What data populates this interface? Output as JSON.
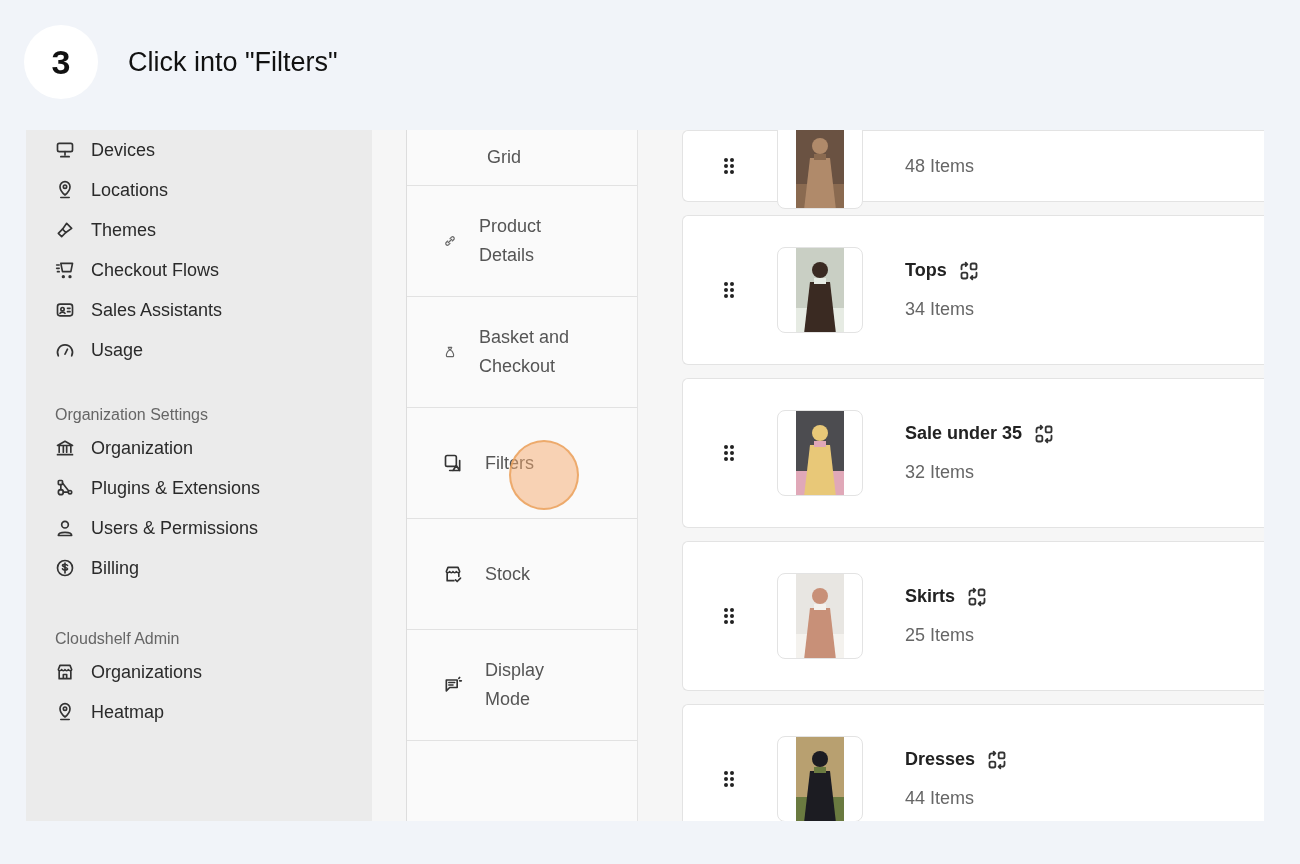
{
  "step": {
    "number": "3",
    "instruction": "Click into \"Filters\""
  },
  "sidebar": {
    "items": [
      {
        "label": "Devices"
      },
      {
        "label": "Locations"
      },
      {
        "label": "Themes"
      },
      {
        "label": "Checkout Flows"
      },
      {
        "label": "Sales Assistants"
      },
      {
        "label": "Usage"
      }
    ],
    "sections": [
      {
        "title": "Organization Settings",
        "items": [
          {
            "label": "Organization"
          },
          {
            "label": "Plugins & Extensions"
          },
          {
            "label": "Users & Permissions"
          },
          {
            "label": "Billing"
          }
        ]
      },
      {
        "title": "Cloudshelf Admin",
        "items": [
          {
            "label": "Organizations"
          },
          {
            "label": "Heatmap"
          }
        ]
      }
    ]
  },
  "settings_nav": [
    {
      "label": "Grid",
      "clicked": false
    },
    {
      "label": "Product Details",
      "clicked": false
    },
    {
      "label": "Basket and Checkout",
      "clicked": false
    },
    {
      "label": "Filters",
      "clicked": true
    },
    {
      "label": "Stock",
      "clicked": false
    },
    {
      "label": "Display Mode",
      "clicked": false
    }
  ],
  "collections": [
    {
      "count": "48 Items"
    },
    {
      "title": "Tops",
      "count": "34 Items"
    },
    {
      "title": "Sale under 35",
      "count": "32 Items"
    },
    {
      "title": "Skirts",
      "count": "25 Items"
    },
    {
      "title": "Dresses",
      "count": "44 Items"
    }
  ]
}
